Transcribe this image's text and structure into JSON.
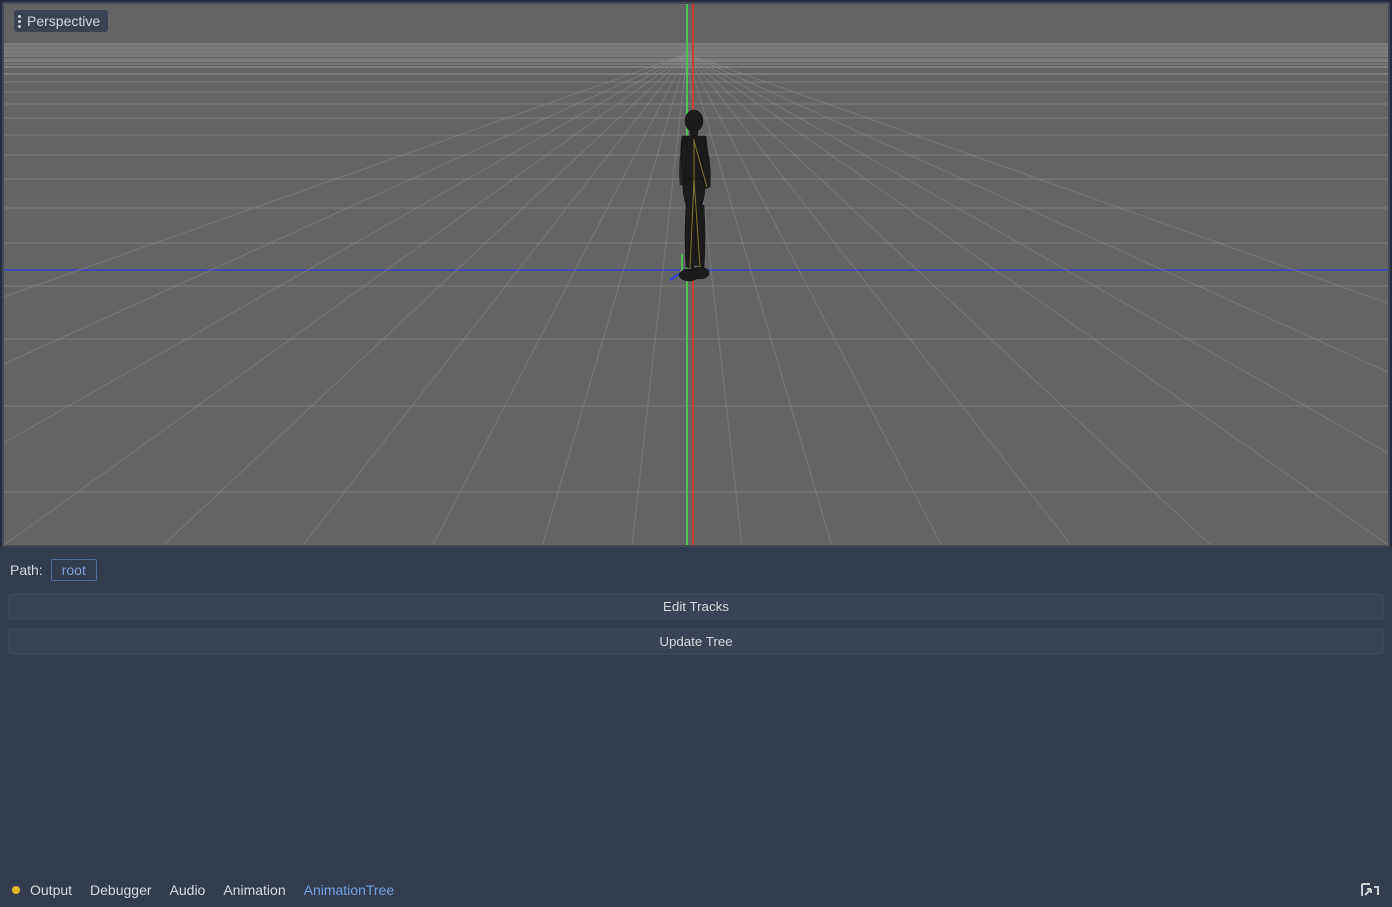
{
  "viewport": {
    "mode_label": "Perspective"
  },
  "panel": {
    "path_label": "Path:",
    "path_value": "root",
    "buttons": {
      "edit_tracks": "Edit Tracks",
      "update_tree": "Update Tree"
    }
  },
  "tabs": {
    "output": "Output",
    "debugger": "Debugger",
    "audio": "Audio",
    "animation": "Animation",
    "animation_tree": "AnimationTree",
    "active": "animation_tree"
  },
  "colors": {
    "axis_x": "#d83a2f",
    "axis_y": "#49c74c",
    "axis_z": "#2a3cf0",
    "grid_bg": "#646464",
    "panel_bg": "#333b4f",
    "accent": "#6fa3e0",
    "status_dot": "#e3bb28"
  },
  "icons": {
    "perspective_menu": "dots-vertical-icon",
    "expand_panel": "expand-icon"
  }
}
